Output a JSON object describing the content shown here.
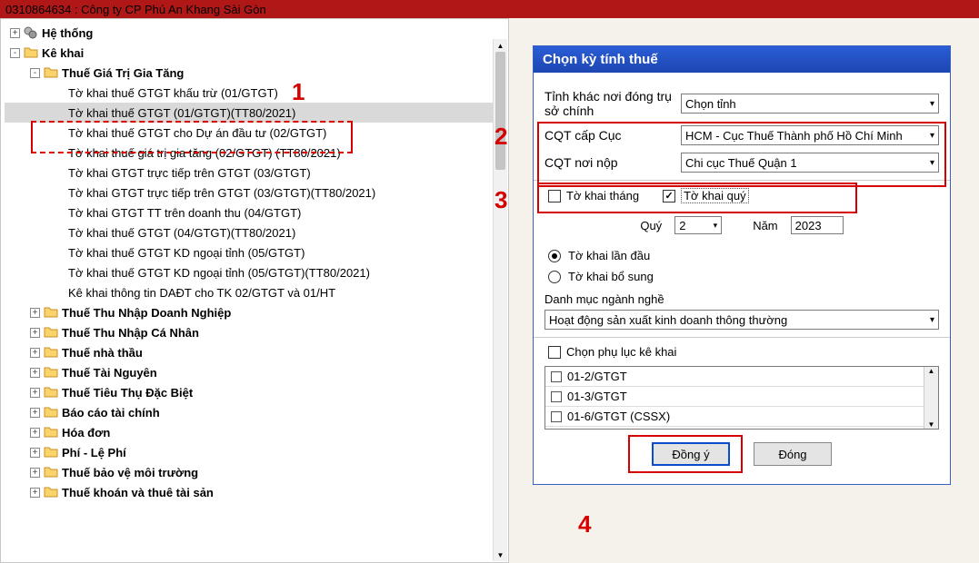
{
  "titlebar": "0310864634 : Công ty CP Phú An Khang Sài Gòn",
  "tree": {
    "root": [
      {
        "label": "Hệ thống",
        "icon": "gear",
        "bold": true,
        "plus": "+",
        "lvl": 0
      },
      {
        "label": "Kê khai",
        "icon": "folder",
        "bold": true,
        "plus": "-",
        "lvl": 0
      },
      {
        "label": "Thuế Giá Trị Gia Tăng",
        "icon": "folder",
        "bold": true,
        "plus": "-",
        "lvl": 1
      },
      {
        "label": "Tờ khai thuế GTGT khấu trừ (01/GTGT)",
        "lvl": 2
      },
      {
        "label": "Tờ khai thuế GTGT (01/GTGT)(TT80/2021)",
        "lvl": 2,
        "sel": true
      },
      {
        "label": "Tờ khai thuế GTGT cho Dự án đầu tư (02/GTGT)",
        "lvl": 2
      },
      {
        "label": "Tờ khai thuế giá trị gia tăng (02/GTGT) (TT80/2021)",
        "lvl": 2
      },
      {
        "label": "Tờ khai GTGT trực tiếp trên GTGT (03/GTGT)",
        "lvl": 2
      },
      {
        "label": "Tờ khai GTGT trực tiếp trên GTGT (03/GTGT)(TT80/2021)",
        "lvl": 2
      },
      {
        "label": "Tờ khai GTGT TT trên doanh thu (04/GTGT)",
        "lvl": 2
      },
      {
        "label": "Tờ khai thuế GTGT (04/GTGT)(TT80/2021)",
        "lvl": 2
      },
      {
        "label": "Tờ khai thuế GTGT KD ngoại tỉnh (05/GTGT)",
        "lvl": 2
      },
      {
        "label": "Tờ khai thuế GTGT KD ngoại tỉnh (05/GTGT)(TT80/2021)",
        "lvl": 2
      },
      {
        "label": "Kê khai thông tin DAĐT cho TK 02/GTGT và 01/HT",
        "lvl": 2
      },
      {
        "label": "Thuế Thu Nhập Doanh Nghiệp",
        "icon": "folder",
        "bold": true,
        "plus": "+",
        "lvl": 1
      },
      {
        "label": "Thuế Thu Nhập Cá Nhân",
        "icon": "folder",
        "bold": true,
        "plus": "+",
        "lvl": 1
      },
      {
        "label": "Thuế nhà thầu",
        "icon": "folder",
        "bold": true,
        "plus": "+",
        "lvl": 1
      },
      {
        "label": "Thuế Tài Nguyên",
        "icon": "folder",
        "bold": true,
        "plus": "+",
        "lvl": 1
      },
      {
        "label": "Thuế Tiêu Thụ Đặc Biệt",
        "icon": "folder",
        "bold": true,
        "plus": "+",
        "lvl": 1
      },
      {
        "label": "Báo cáo tài chính",
        "icon": "folder",
        "bold": true,
        "plus": "+",
        "lvl": 1
      },
      {
        "label": "Hóa đơn",
        "icon": "folder",
        "bold": true,
        "plus": "+",
        "lvl": 1
      },
      {
        "label": "Phí - Lệ Phí",
        "icon": "folder",
        "bold": true,
        "plus": "+",
        "lvl": 1
      },
      {
        "label": "Thuế bảo vệ môi trường",
        "icon": "folder",
        "bold": true,
        "plus": "+",
        "lvl": 1
      },
      {
        "label": "Thuế khoán và thuê tài sản",
        "icon": "folder",
        "bold": true,
        "plus": "+",
        "lvl": 1
      }
    ]
  },
  "panel": {
    "title": "Chọn kỳ tính thuế",
    "prov_label": "Tỉnh khác nơi đóng trụ sở chính",
    "prov_value": "Chọn tỉnh",
    "cqt_cap_cuc_label": "CQT cấp Cục",
    "cqt_cap_cuc_value": "HCM - Cục Thuế Thành phố Hồ Chí Minh",
    "cqt_noinop_label": "CQT nơi nộp",
    "cqt_noinop_value": "Chi cục Thuế Quận 1",
    "chk_month_label": "Tờ khai tháng",
    "chk_quarter_label": "Tờ khai quý",
    "quy_label": "Quý",
    "quy_value": "2",
    "nam_label": "Năm",
    "nam_value": "2023",
    "radio_first": "Tờ khai lần đầu",
    "radio_supp": "Tờ khai bổ sung",
    "dm_label": "Danh mục ngành nghề",
    "dm_value": "Hoạt động sản xuất kinh doanh thông thường",
    "pl_label": "Chọn phụ lục kê khai",
    "pl_items": [
      "01-2/GTGT",
      "01-3/GTGT",
      "01-6/GTGT (CSSX)"
    ],
    "btn_ok": "Đồng ý",
    "btn_close": "Đóng"
  },
  "annotations": {
    "a1": "1",
    "a2": "2",
    "a3": "3",
    "a4": "4"
  }
}
